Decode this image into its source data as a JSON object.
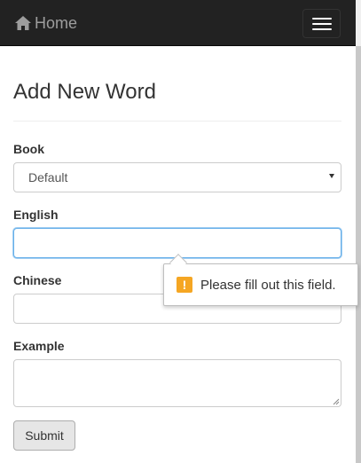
{
  "navbar": {
    "brand_icon": "home-icon",
    "brand_label": "Home",
    "toggle_icon": "hamburger-icon"
  },
  "page": {
    "title": "Add New Word"
  },
  "form": {
    "book": {
      "label": "Book",
      "value": "Default"
    },
    "english": {
      "label": "English",
      "value": ""
    },
    "chinese": {
      "label": "Chinese",
      "value": ""
    },
    "example": {
      "label": "Example",
      "value": ""
    },
    "submit_label": "Submit"
  },
  "validation": {
    "icon": "warning-icon",
    "icon_glyph": "!",
    "message": "Please fill out this field."
  },
  "colors": {
    "navbar_bg": "#222222",
    "brand_text": "#9d9d9d",
    "focus_border": "#66afe9",
    "warning": "#f5a623"
  }
}
